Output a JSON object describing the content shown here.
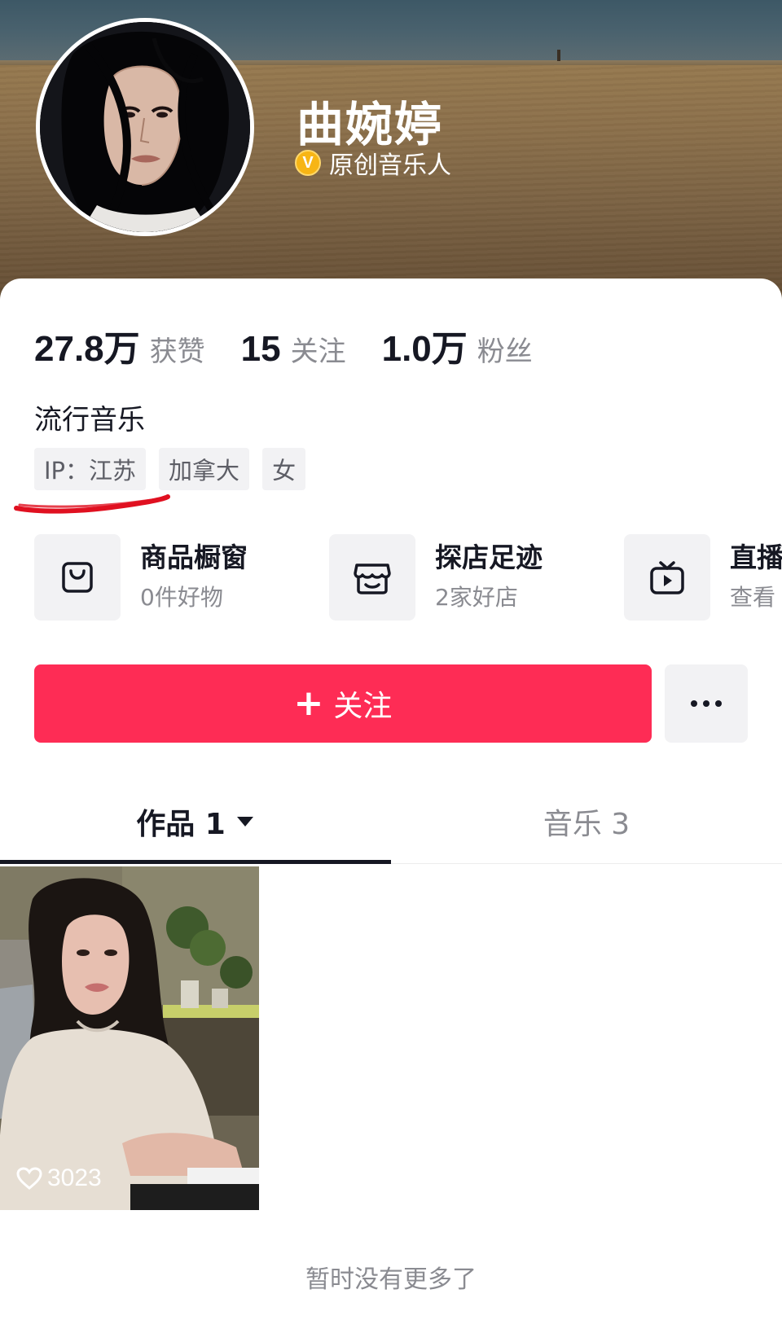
{
  "profile": {
    "name": "曲婉婷",
    "verified_badge": "V",
    "verified_text": "原创音乐人",
    "bio": "流行音乐",
    "tags": [
      "IP：江苏",
      "加拿大",
      "女"
    ]
  },
  "stats": [
    {
      "value": "27.8万",
      "label": "获赞"
    },
    {
      "value": "15",
      "label": "关注"
    },
    {
      "value": "1.0万",
      "label": "粉丝"
    }
  ],
  "features": [
    {
      "icon": "shopping-bag-icon",
      "title": "商品橱窗",
      "subtitle": "0件好物"
    },
    {
      "icon": "store-icon",
      "title": "探店足迹",
      "subtitle": "2家好店"
    },
    {
      "icon": "tv-play-icon",
      "title": "直播",
      "subtitle": "查看"
    }
  ],
  "actions": {
    "follow_label": "关注",
    "follow_plus": "+"
  },
  "tabs": [
    {
      "label": "作品 1",
      "active": true
    },
    {
      "label": "音乐 3",
      "active": false
    }
  ],
  "videos": [
    {
      "likes": "3023"
    }
  ],
  "footer": {
    "no_more_text": "暂时没有更多了"
  },
  "colors": {
    "accent": "#fe2c55",
    "badge": "#f7b515",
    "text_primary": "#161823",
    "text_secondary": "#8a8b91",
    "annotation_red": "#e01020"
  }
}
